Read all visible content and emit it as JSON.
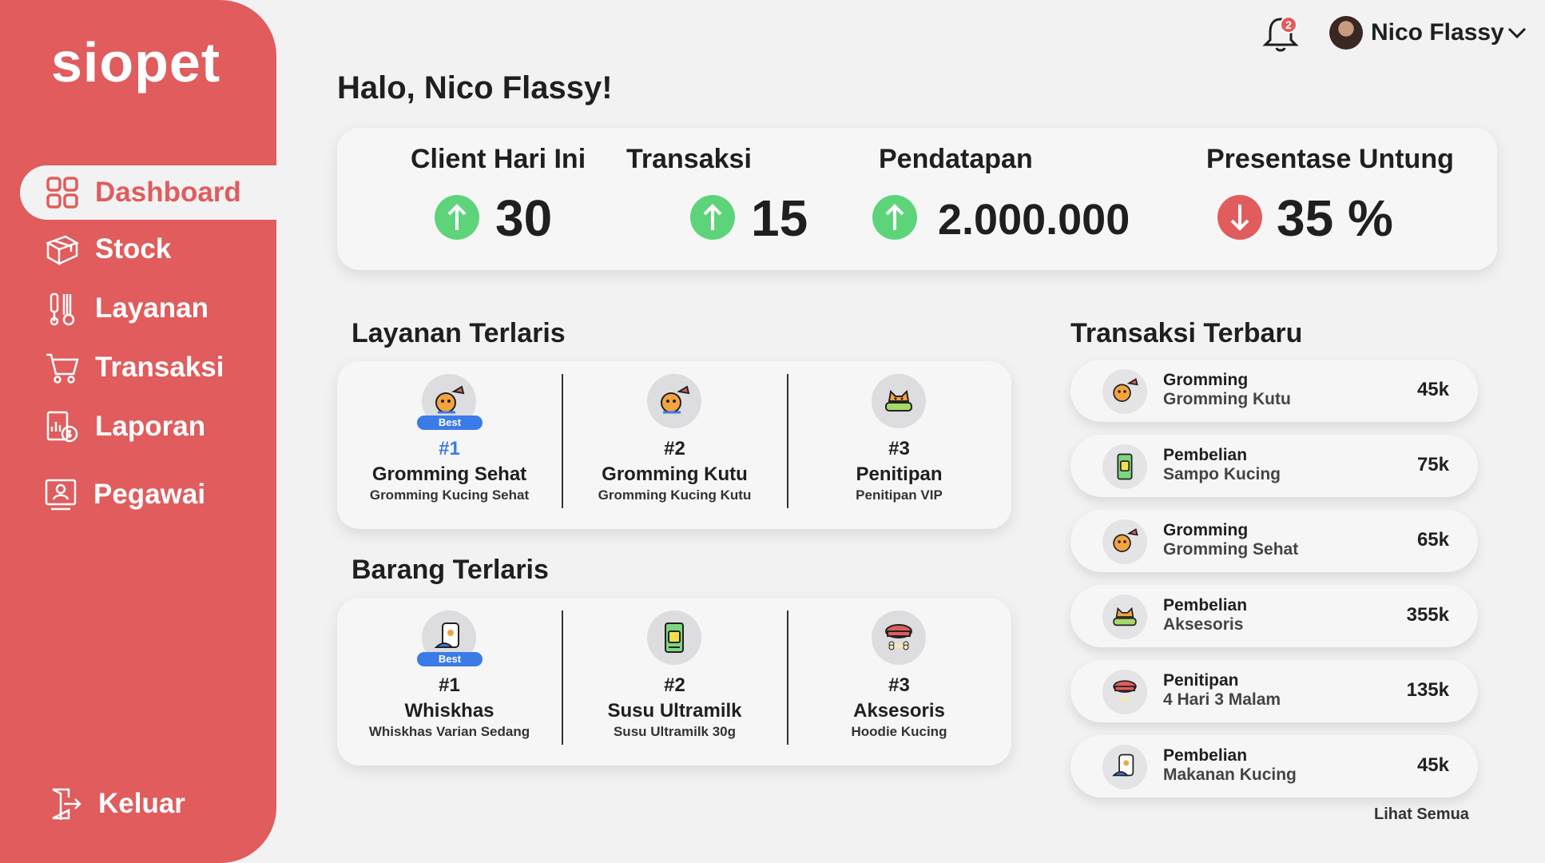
{
  "brand": {
    "logo": "siopet",
    "accent": "#e05c5d",
    "blue": "#3b7be8",
    "green": "#5dd47a"
  },
  "sidebar": {
    "items": [
      {
        "label": "Dashboard",
        "icon": "grid-icon",
        "active": true
      },
      {
        "label": "Stock",
        "icon": "box-icon"
      },
      {
        "label": "Layanan",
        "icon": "grooming-tools-icon"
      },
      {
        "label": "Transaksi",
        "icon": "cart-icon"
      },
      {
        "label": "Laporan",
        "icon": "report-icon"
      },
      {
        "label": "Pegawai",
        "icon": "employee-icon"
      }
    ],
    "logout": {
      "label": "Keluar",
      "icon": "logout-icon"
    }
  },
  "header": {
    "notification_count": "2",
    "user_name": "Nico Flassy"
  },
  "greeting": "Halo, Nico Flassy!",
  "stats": [
    {
      "title": "Client Hari Ini",
      "value": "30",
      "trend": "up"
    },
    {
      "title": "Transaksi",
      "value": "15",
      "trend": "up"
    },
    {
      "title": "Pendatapan",
      "value": "2.000.000",
      "trend": "up"
    },
    {
      "title": "Presentase Untung",
      "value": "35 %",
      "trend": "down"
    }
  ],
  "layanan_terlaris": {
    "title": "Layanan Terlaris",
    "items": [
      {
        "rank": "#1",
        "name": "Gromming Sehat",
        "sub": "Gromming Kucing Sehat",
        "best": "Best",
        "icon": "dog-grooming-icon"
      },
      {
        "rank": "#2",
        "name": "Gromming Kutu",
        "sub": "Gromming Kucing Kutu",
        "icon": "dog-grooming-icon"
      },
      {
        "rank": "#3",
        "name": "Penitipan",
        "sub": "Penitipan VIP",
        "icon": "cat-bed-icon"
      }
    ]
  },
  "barang_terlaris": {
    "title": "Barang Terlaris",
    "items": [
      {
        "rank": "#1",
        "name": "Whiskhas",
        "sub": "Whiskhas Varian Sedang",
        "best": "Best",
        "icon": "pet-food-icon"
      },
      {
        "rank": "#2",
        "name": "Susu Ultramilk",
        "sub": "Susu Ultramilk 30g",
        "icon": "milk-pack-icon"
      },
      {
        "rank": "#3",
        "name": "Aksesoris",
        "sub": "Hoodie Kucing",
        "icon": "collar-bone-icon"
      }
    ]
  },
  "transaksi_terbaru": {
    "title": "Transaksi Terbaru",
    "items": [
      {
        "title": "Gromming",
        "sub": "Gromming Kutu",
        "amount": "45k",
        "icon": "dog-grooming-icon"
      },
      {
        "title": "Pembelian",
        "sub": "Sampo Kucing",
        "amount": "75k",
        "icon": "shampoo-icon"
      },
      {
        "title": "Gromming",
        "sub": "Gromming Sehat",
        "amount": "65k",
        "icon": "dog-grooming-icon"
      },
      {
        "title": "Pembelian",
        "sub": "Aksesoris",
        "amount": "355k",
        "icon": "cat-bed-icon"
      },
      {
        "title": "Penitipan",
        "sub": "4 Hari 3 Malam",
        "amount": "135k",
        "icon": "collar-bone-icon"
      },
      {
        "title": "Pembelian",
        "sub": "Makanan Kucing",
        "amount": "45k",
        "icon": "pet-food-icon"
      }
    ],
    "see_all": "Lihat Semua"
  }
}
